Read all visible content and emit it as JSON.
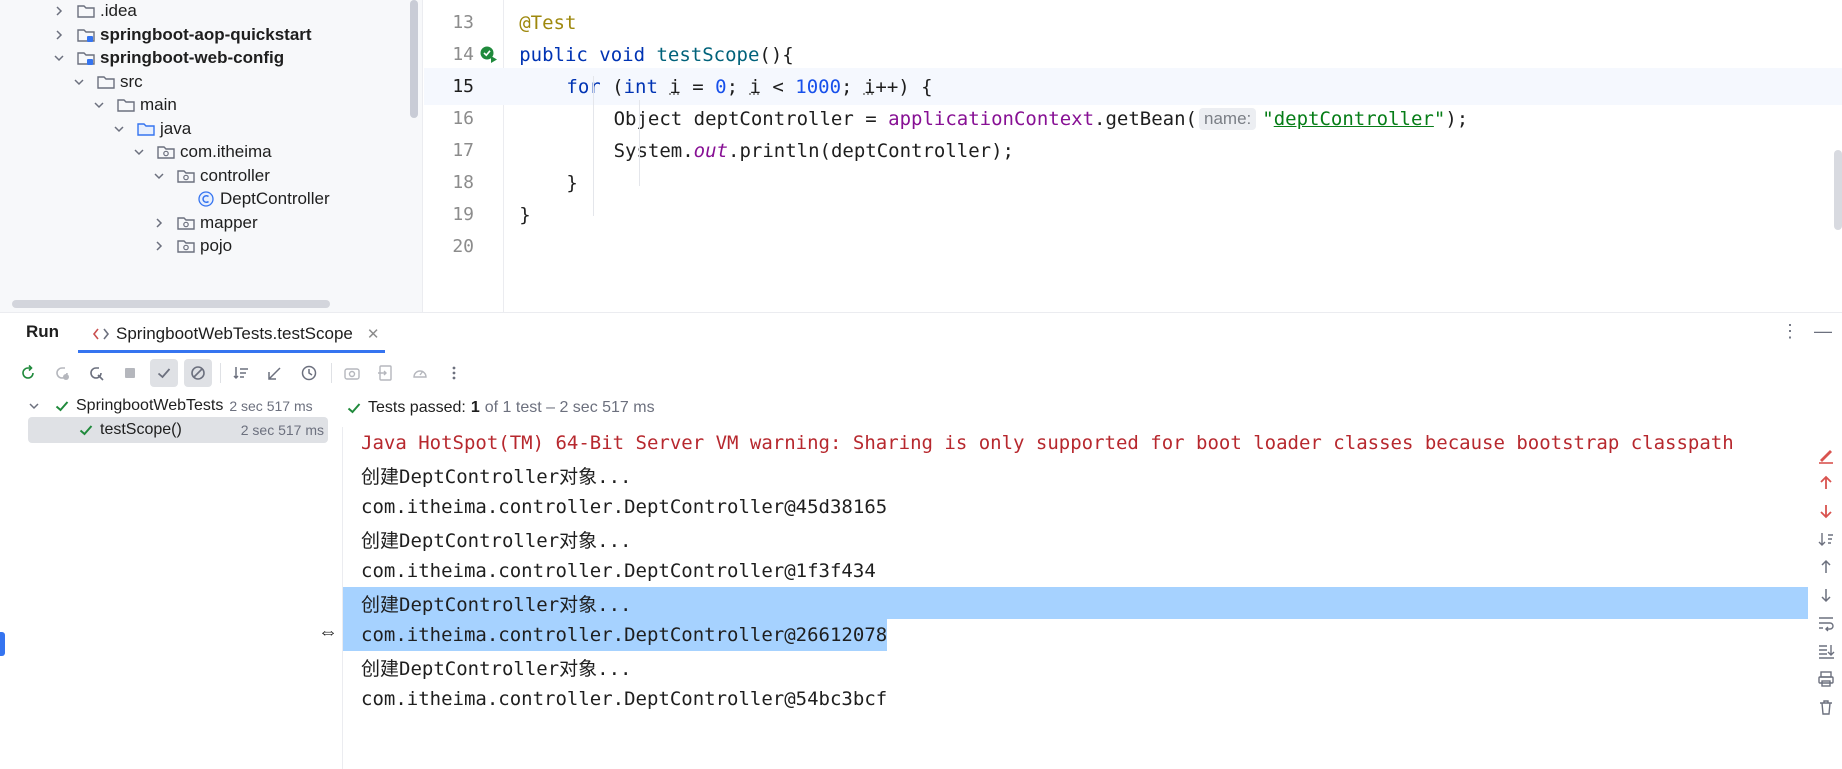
{
  "project_tree": {
    "items": [
      {
        "label": ".idea",
        "bold": false,
        "depth": 0,
        "expanded": false,
        "icon": "folder-icon"
      },
      {
        "label": "springboot-aop-quickstart",
        "bold": true,
        "depth": 0,
        "expanded": false,
        "icon": "module-folder-icon"
      },
      {
        "label": "springboot-web-config",
        "bold": true,
        "depth": 0,
        "expanded": true,
        "icon": "module-folder-icon"
      },
      {
        "label": "src",
        "bold": false,
        "depth": 1,
        "expanded": true,
        "icon": "folder-icon"
      },
      {
        "label": "main",
        "bold": false,
        "depth": 2,
        "expanded": true,
        "icon": "folder-icon"
      },
      {
        "label": "java",
        "bold": false,
        "depth": 3,
        "expanded": true,
        "icon": "source-folder-icon"
      },
      {
        "label": "com.itheima",
        "bold": false,
        "depth": 4,
        "expanded": true,
        "icon": "package-icon"
      },
      {
        "label": "controller",
        "bold": false,
        "depth": 5,
        "expanded": true,
        "icon": "package-icon"
      },
      {
        "label": "DeptController",
        "bold": false,
        "depth": 6,
        "expanded": null,
        "icon": "class-icon"
      },
      {
        "label": "mapper",
        "bold": false,
        "depth": 5,
        "expanded": false,
        "icon": "package-icon"
      },
      {
        "label": "pojo",
        "bold": false,
        "depth": 5,
        "expanded": false,
        "icon": "package-icon"
      }
    ]
  },
  "editor": {
    "current_line": "15",
    "lines": [
      {
        "num": "13",
        "t": [
          {
            "c": "ann",
            "v": "@Test"
          }
        ]
      },
      {
        "num": "14",
        "t": [
          {
            "c": "kw",
            "v": "public void "
          },
          {
            "c": "fn",
            "v": "testScope"
          },
          {
            "c": "",
            "v": "(){"
          }
        ]
      },
      {
        "num": "15",
        "t": [
          {
            "c": "kw",
            "v": "for "
          },
          {
            "c": "",
            "v": "("
          },
          {
            "c": "kw",
            "v": "int "
          },
          {
            "c": "ul",
            "v": "i"
          },
          {
            "c": "",
            "v": " = "
          },
          {
            "c": "num",
            "v": "0"
          },
          {
            "c": "",
            "v": "; "
          },
          {
            "c": "ul",
            "v": "i"
          },
          {
            "c": "",
            "v": " < "
          },
          {
            "c": "num",
            "v": "1000"
          },
          {
            "c": "",
            "v": "; "
          },
          {
            "c": "ul",
            "v": "i"
          },
          {
            "c": "",
            "v": "++) {"
          }
        ]
      },
      {
        "num": "16",
        "t": [
          {
            "c": "",
            "v": "Object deptController = "
          },
          {
            "c": "fld",
            "v": "applicationContext"
          },
          {
            "c": "",
            "v": ".getBean("
          },
          {
            "c": "hint",
            "v": "name:"
          },
          {
            "c": "str",
            "v": "\""
          },
          {
            "c": "strul",
            "v": "deptController"
          },
          {
            "c": "str",
            "v": "\""
          },
          {
            "c": "",
            "v": ");"
          }
        ]
      },
      {
        "num": "17",
        "t": [
          {
            "c": "",
            "v": "System."
          },
          {
            "c": "static",
            "v": "out"
          },
          {
            "c": "",
            "v": ".println(deptController);"
          }
        ]
      },
      {
        "num": "18",
        "t": [
          {
            "c": "",
            "v": "}"
          }
        ]
      },
      {
        "num": "19",
        "t": [
          {
            "c": "",
            "v": "}"
          }
        ]
      },
      {
        "num": "20",
        "t": []
      }
    ]
  },
  "run": {
    "title": "Run",
    "tab_label": "SpringbootWebTests.testScope",
    "tests": [
      {
        "name": "SpringbootWebTests",
        "duration": "2 sec 517 ms",
        "selected": false
      },
      {
        "name": "testScope()",
        "duration": "2 sec 517 ms",
        "selected": true
      }
    ],
    "status": {
      "prefix": "Tests passed:",
      "count": "1",
      "suffix": "of 1 test – 2 sec 517 ms"
    },
    "console": [
      {
        "text": "Java HotSpot(TM) 64-Bit Server VM warning: Sharing is only supported for boot loader classes because bootstrap classpath",
        "kind": "warn"
      },
      {
        "text": "创建DeptController对象...",
        "kind": "normal"
      },
      {
        "text": "com.itheima.controller.DeptController@45d38165",
        "kind": "normal"
      },
      {
        "text": "创建DeptController对象...",
        "kind": "normal"
      },
      {
        "text": "com.itheima.controller.DeptController@1f3f434",
        "kind": "normal"
      },
      {
        "text": "创建DeptController对象...",
        "kind": "hl-full"
      },
      {
        "text": "com.itheima.controller.DeptController@26612078",
        "kind": "hl-part"
      },
      {
        "text": "创建DeptController对象...",
        "kind": "normal"
      },
      {
        "text": "com.itheima.controller.DeptController@54bc3bcf",
        "kind": "normal"
      }
    ]
  },
  "colors": {
    "accent": "#3574f0",
    "success": "#208a3c",
    "warning_text": "#b7282e",
    "selection": "#a6d2ff"
  }
}
